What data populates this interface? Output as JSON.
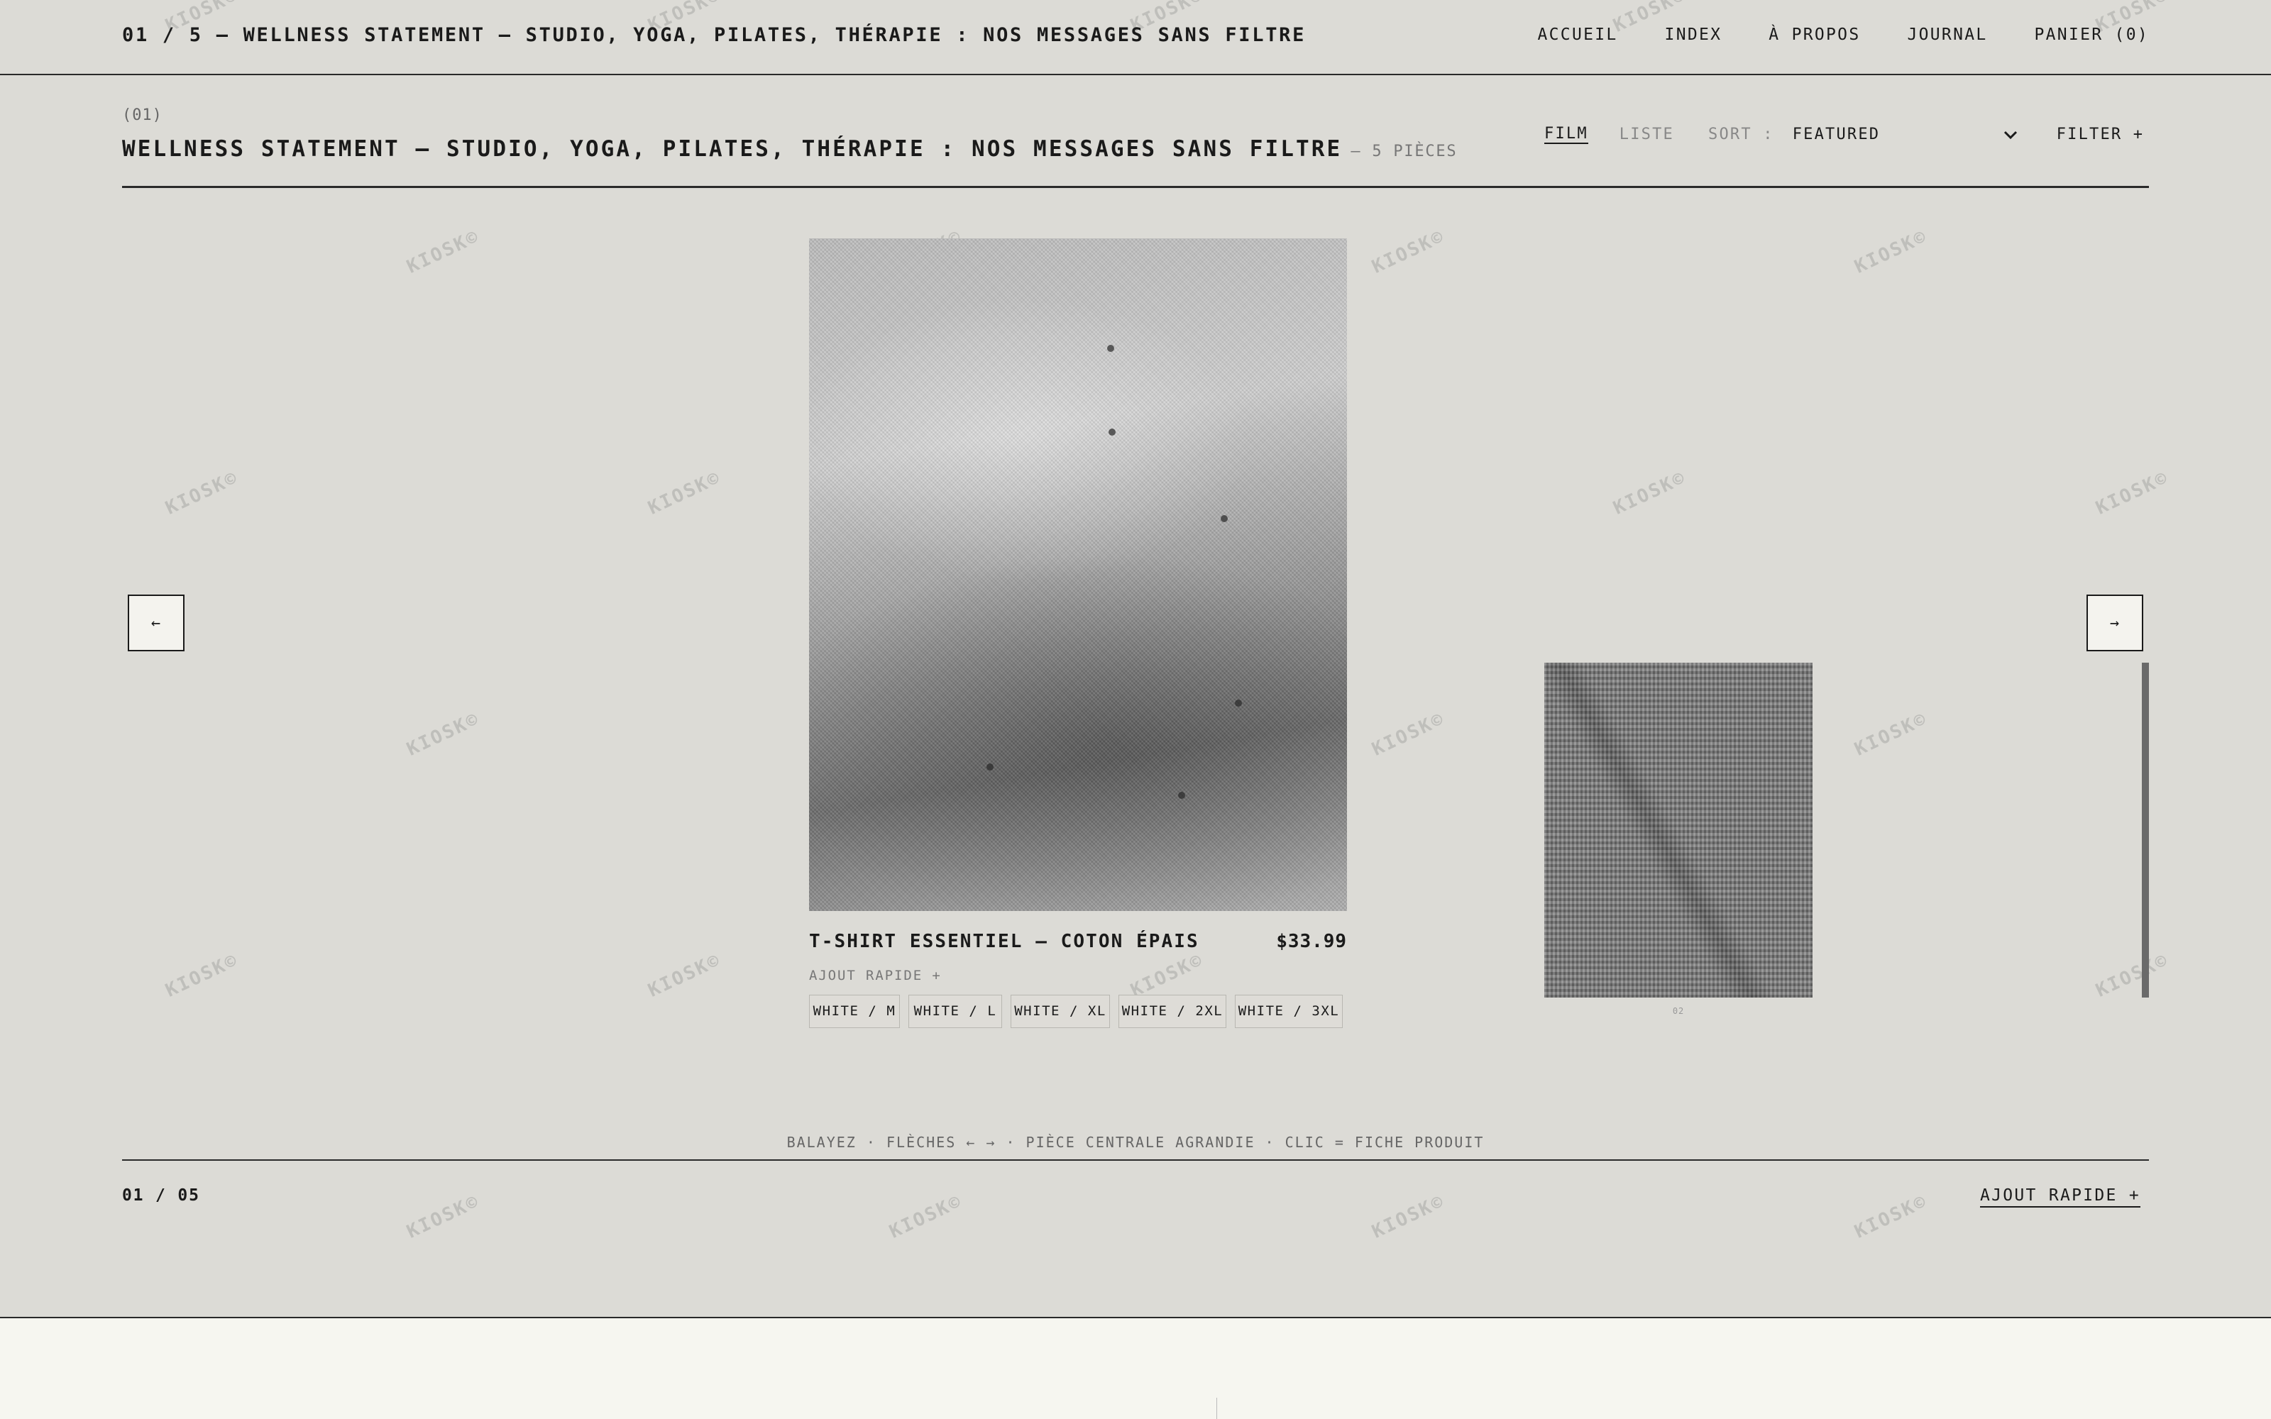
{
  "header": {
    "title": "01 / 5 — WELLNESS STATEMENT – STUDIO, YOGA, PILATES, THÉRAPIE : NOS MESSAGES SANS FILTRE",
    "nav": [
      "ACCUEIL",
      "INDEX",
      "À PROPOS",
      "JOURNAL",
      "PANIER (0)"
    ]
  },
  "collection": {
    "index": "(01)",
    "title": "WELLNESS STATEMENT – STUDIO, YOGA, PILATES, THÉRAPIE : NOS MESSAGES SANS FILTRE",
    "count": "— 5 PIÈCES"
  },
  "controls": {
    "view_film": "FILM",
    "view_liste": "LISTE",
    "sort_label": "SORT :",
    "sort_value": "FEATURED",
    "filter": "FILTER +"
  },
  "carousel": {
    "prev_icon": "←",
    "next_icon": "→",
    "main": {
      "name": "T-SHIRT ESSENTIEL — COTON ÉPAIS",
      "price": "$33.99",
      "quick_add": "AJOUT RAPIDE +",
      "variants": [
        "WHITE / M",
        "WHITE / L",
        "WHITE / XL",
        "WHITE / 2XL",
        "WHITE / 3XL"
      ]
    },
    "side_caption": "02"
  },
  "hint": "BALAYEZ · FLÈCHES ← → · PIÈCE CENTRALE AGRANDIE · CLIC = FICHE PRODUIT",
  "footer": {
    "counter": "01 / 05",
    "quick_add": "AJOUT RAPIDE +"
  },
  "watermark": "KIOSK©"
}
